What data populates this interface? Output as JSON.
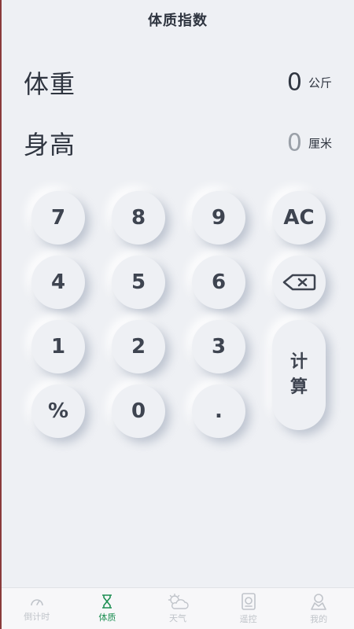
{
  "header": {
    "title": "体质指数"
  },
  "weight": {
    "label": "体重",
    "value": "0",
    "unit": "公斤"
  },
  "height": {
    "label": "身高",
    "value": "0",
    "unit": "厘米"
  },
  "keypad": {
    "k7": "7",
    "k8": "8",
    "k9": "9",
    "clear": "AC",
    "k4": "4",
    "k5": "5",
    "k6": "6",
    "k1": "1",
    "k2": "2",
    "k3": "3",
    "percent": "%",
    "k0": "0",
    "dot": ".",
    "calc_1": "计",
    "calc_2": "算"
  },
  "tabs": [
    {
      "label": "倒计时",
      "icon": "gauge-icon"
    },
    {
      "label": "体质",
      "icon": "hourglass-icon"
    },
    {
      "label": "天气",
      "icon": "cloud-sun-icon"
    },
    {
      "label": "遥控",
      "icon": "remote-icon"
    },
    {
      "label": "我的",
      "icon": "user-icon"
    }
  ],
  "colors": {
    "background": "#eef0f4",
    "accent": "#1f8f54",
    "text": "#2f3540",
    "muted": "#c0c4ca"
  }
}
